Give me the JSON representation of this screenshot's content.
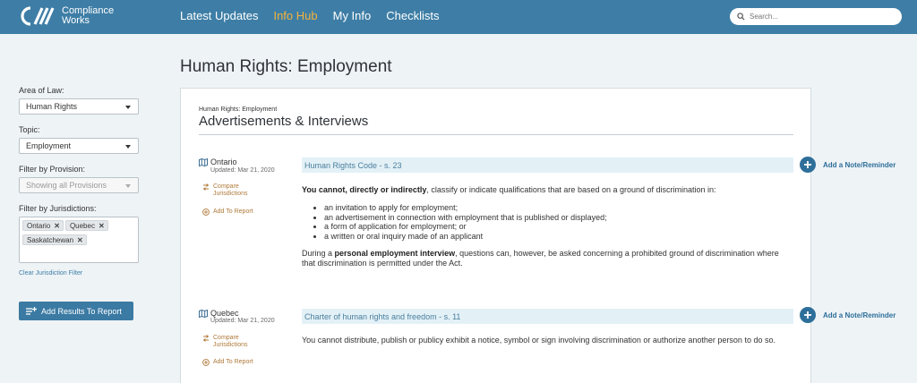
{
  "header": {
    "logo_line1": "Compliance",
    "logo_line2": "Works",
    "nav": [
      "Latest Updates",
      "Info Hub",
      "My Info",
      "Checklists"
    ],
    "active_nav": "Info Hub",
    "search_placeholder": "Search..."
  },
  "page_title": "Human Rights: Employment",
  "sidebar": {
    "area_label": "Area of Law:",
    "area_value": "Human Rights",
    "topic_label": "Topic:",
    "topic_value": "Employment",
    "provision_label": "Filter by Provision:",
    "provision_value": "Showing all Provisions",
    "jurisdictions_label": "Filter by Jurisdictions:",
    "jurisdictions": [
      "Ontario",
      "Quebec",
      "Saskatchewan"
    ],
    "clear_label": "Clear Jurisdiction Filter",
    "add_results_label": "Add Results To Report"
  },
  "content": {
    "crumb": "Human Rights: Employment",
    "section_title": "Advertisements & Interviews",
    "compare_label_1": "Compare",
    "compare_label_2": "Jurisdictions",
    "add_report_label": "Add To Report",
    "note_label": "Add a Note/Reminder",
    "entries": [
      {
        "jurisdiction": "Ontario",
        "updated": "Updated: Mar 21, 2020",
        "provision": "Human Rights Code - s. 23",
        "intro_bold": "You cannot, directly or indirectly",
        "intro_rest": ", classify or indicate qualifications that are based on a ground of discrimination in:",
        "bullets": [
          "an invitation to apply for employment;",
          "an advertisement in connection with employment that is published or displayed;",
          "a form of application for employment; or",
          "a written or oral inquiry made of an applicant"
        ],
        "outro_pre": "During a ",
        "outro_bold": "personal employment interview",
        "outro_rest": ", questions can, however, be asked concerning a prohibited ground of discrimination where that discrimination is permitted under the Act."
      },
      {
        "jurisdiction": "Quebec",
        "updated": "Updated: Mar 21, 2020",
        "provision": "Charter of human rights and freedom - s. 11",
        "text": "You cannot distribute, publish or publicy exhibit a notice, symbol or sign involving discrimination or authorize another person to do so."
      }
    ]
  }
}
